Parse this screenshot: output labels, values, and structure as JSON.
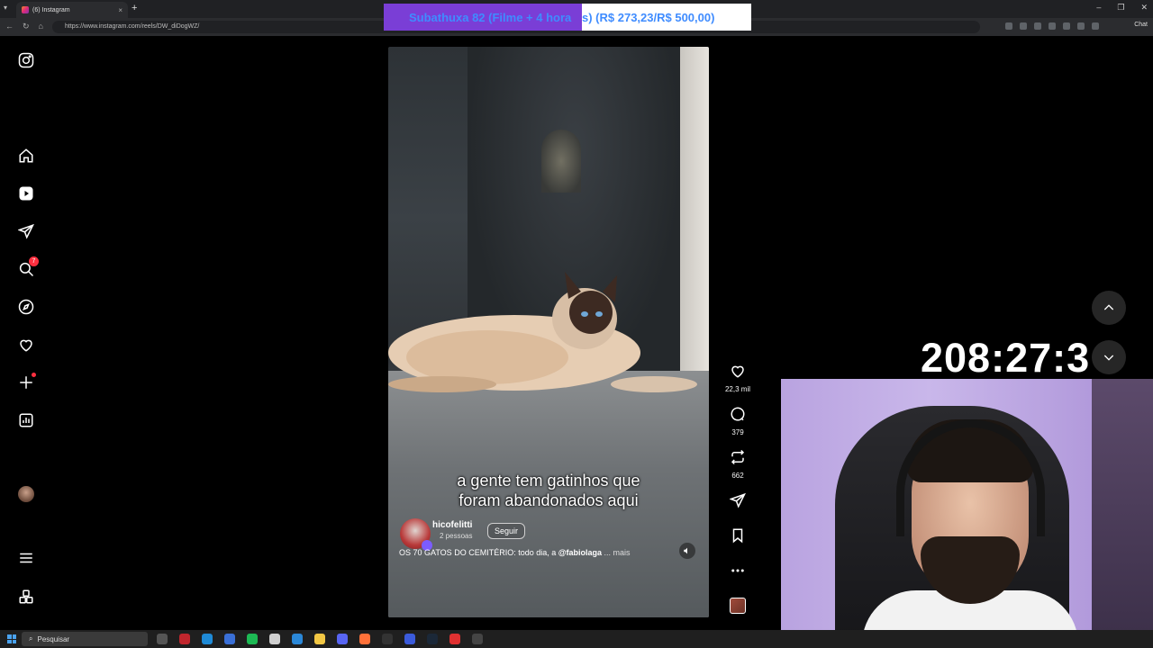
{
  "browser": {
    "tab_title": "(6) Instagram",
    "tab_close": "×",
    "new_tab": "+",
    "url": "https://www.instagram.com/reels/DW_diDogWZ/",
    "profile_label": "Chat"
  },
  "subathon": {
    "left_text": "Subathuxa 82 (Filme + 4 hora",
    "right_text": "s) (R$ 273,23/R$ 500,00)"
  },
  "sidebar": {
    "notification_count": "7"
  },
  "reel": {
    "subtitle_line1": "a gente tem gatinhos que",
    "subtitle_line2": "foram abandonados aqui",
    "author": "hicofelitti",
    "followers_hint": "2 pessoas",
    "follow_label": "Seguir",
    "caption_prefix": "OS 70 GATOS DO CEMITÉRIO: todo dia, a ",
    "caption_mention": "@fabiolaga",
    "caption_more": " ... mais"
  },
  "actions": {
    "likes": "22,3 mil",
    "comments": "379",
    "reposts": "662"
  },
  "overlay": {
    "timer": "208:27:3"
  },
  "taskbar": {
    "search_placeholder": "Pesquisar"
  },
  "colors": {
    "background": "#000000",
    "banner_purple": "#7a3ed6",
    "banner_text": "#3f8cff",
    "notification_red": "#ff3040"
  }
}
